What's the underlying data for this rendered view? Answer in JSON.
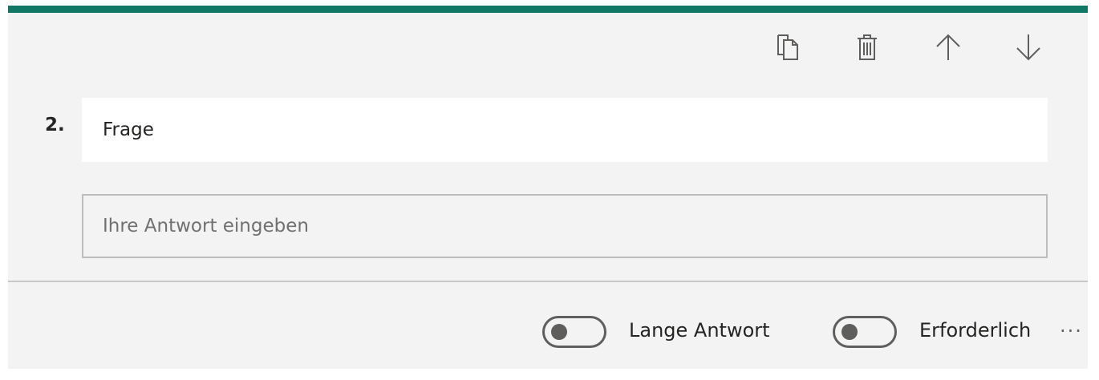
{
  "theme": {
    "accent": "#117865",
    "card_background": "#f3f3f3"
  },
  "toolbar": {
    "copy_icon": "copy-icon",
    "delete_icon": "trash-icon",
    "move_up_icon": "arrow-up-icon",
    "move_down_icon": "arrow-down-icon"
  },
  "question": {
    "number": "2.",
    "title_value": "Frage",
    "answer_placeholder": "Ihre Antwort eingeben"
  },
  "footer": {
    "long_answer_label": "Lange Antwort",
    "long_answer_on": false,
    "required_label": "Erforderlich",
    "required_on": false,
    "more_label": "···"
  }
}
